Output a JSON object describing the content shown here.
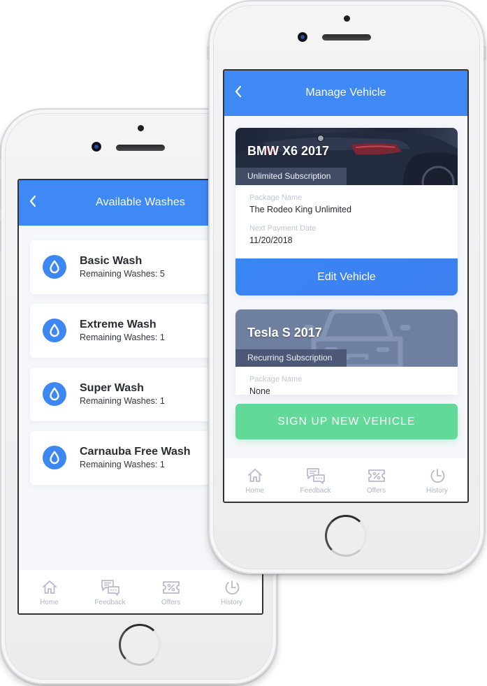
{
  "colors": {
    "primary": "#3f89f5",
    "success": "#62d998",
    "tab_inactive": "#b7b9cc",
    "background": "#f6f7fb"
  },
  "left_screen": {
    "header": {
      "back_icon": "chevron-left-icon",
      "title": "Available Washes"
    },
    "washes": [
      {
        "icon": "water-drop-icon",
        "name": "Basic Wash",
        "remaining": "Remaining Washes: 5"
      },
      {
        "icon": "water-drop-icon",
        "name": "Extreme Wash",
        "remaining": "Remaining Washes: 1"
      },
      {
        "icon": "water-drop-icon",
        "name": "Super Wash",
        "remaining": "Remaining Washes: 1"
      },
      {
        "icon": "water-drop-icon",
        "name": "Carnauba Free Wash",
        "remaining": "Remaining Washes: 1"
      }
    ],
    "tabbar": [
      {
        "icon": "home-icon",
        "label": "Home"
      },
      {
        "icon": "feedback-icon",
        "label": "Feedback"
      },
      {
        "icon": "offers-icon",
        "label": "Offers"
      },
      {
        "icon": "history-icon",
        "label": "History"
      }
    ]
  },
  "right_screen": {
    "header": {
      "back_icon": "chevron-left-icon",
      "title": "Manage Vehicle"
    },
    "vehicles": [
      {
        "name": "BMW X6 2017",
        "subscription": "Unlimited Subscription",
        "package_label": "Package Name",
        "package_value": "The Rodeo King Unlimited",
        "payment_label": "Next Payment Date",
        "payment_value": "11/20/2018",
        "action": "Edit Vehicle"
      },
      {
        "name": "Tesla S 2017",
        "subscription": "Recurring Subscription",
        "package_label": "Package Name",
        "package_value": "None"
      }
    ],
    "signup_button": "SIGN UP NEW VEHICLE",
    "tabbar": [
      {
        "icon": "home-icon",
        "label": "Home"
      },
      {
        "icon": "feedback-icon",
        "label": "Feedback"
      },
      {
        "icon": "offers-icon",
        "label": "Offers"
      },
      {
        "icon": "history-icon",
        "label": "History"
      }
    ]
  }
}
